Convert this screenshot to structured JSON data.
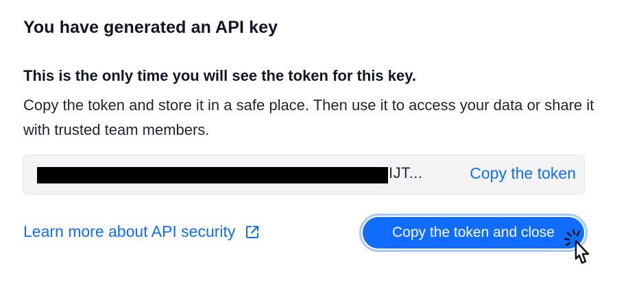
{
  "dialog": {
    "title": "You have generated an API key",
    "warning": "This is the only time you will see the token for this key.",
    "description": "Copy the token and store it in a safe place. Then use it to access your data or share it with trusted team members."
  },
  "token": {
    "visible_suffix": "IJT...",
    "redacted": true,
    "copy_label": "Copy the token"
  },
  "footer": {
    "learn_more_label": "Learn more about API security",
    "learn_more_icon": "external-link-icon",
    "primary_button_label": "Copy the token and close"
  },
  "colors": {
    "accent": "#116dff",
    "text": "#131525",
    "field_bg": "#f4f4f6",
    "focus_ring": "#a9c8ff"
  },
  "cursor_icon": "pointer-hand-icon"
}
